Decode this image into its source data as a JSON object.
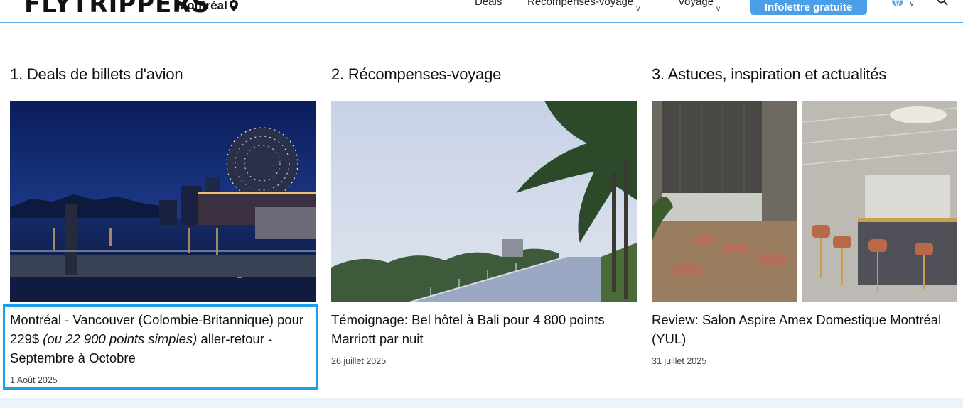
{
  "header": {
    "logo": "FLYTRIPPERS",
    "city": "Montréal",
    "nav": {
      "deals": "Deals",
      "rewards": "Récompenses-voyage",
      "travel": "Voyage"
    },
    "signup_label": "Infolettre gratuite",
    "icons": [
      "location-pin-icon",
      "globe-icon",
      "search-icon"
    ]
  },
  "columns": [
    {
      "title": "1. Deals de billets d'avion",
      "article_title_a": "Montréal - Vancouver (Colombie-Britannique) pour 229$ ",
      "article_title_em": "(ou 22 900 points simples)",
      "article_title_b": " aller-retour - Septembre à Octobre",
      "date": "1 Août 2025"
    },
    {
      "title": "2. Récompenses-voyage",
      "article_title": "Témoignage: Bel hôtel à Bali pour 4 800 points Marriott par nuit",
      "date": "26 juillet 2025"
    },
    {
      "title": "3. Astuces, inspiration et actualités",
      "article_title": "Review: Salon Aspire Amex Domestique Montréal (YUL)",
      "date": "31 juillet 2025"
    }
  ],
  "colors": {
    "accent": "#4a9fe8",
    "highlight": "#1a9fe8"
  }
}
